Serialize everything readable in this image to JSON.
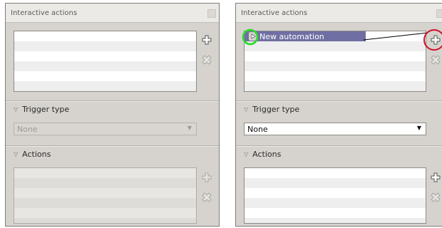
{
  "left_panel": {
    "title": "Interactive actions",
    "trigger_section": "Trigger type",
    "trigger_value": "None",
    "actions_section": "Actions"
  },
  "right_panel": {
    "title": "Interactive actions",
    "automation_item": "New automation",
    "trigger_section": "Trigger type",
    "trigger_value": "None",
    "actions_section": "Actions"
  },
  "icons": {
    "add": "plus-icon",
    "remove": "cross-icon",
    "expand": "triangle-down-icon",
    "dropdown": "chevron-down-icon",
    "item": "play-icon"
  },
  "colors": {
    "panel_bg": "#d6d3ce",
    "selection": "#6f6fa3",
    "highlight_green": "#22dd22",
    "highlight_red": "#d0102a"
  }
}
